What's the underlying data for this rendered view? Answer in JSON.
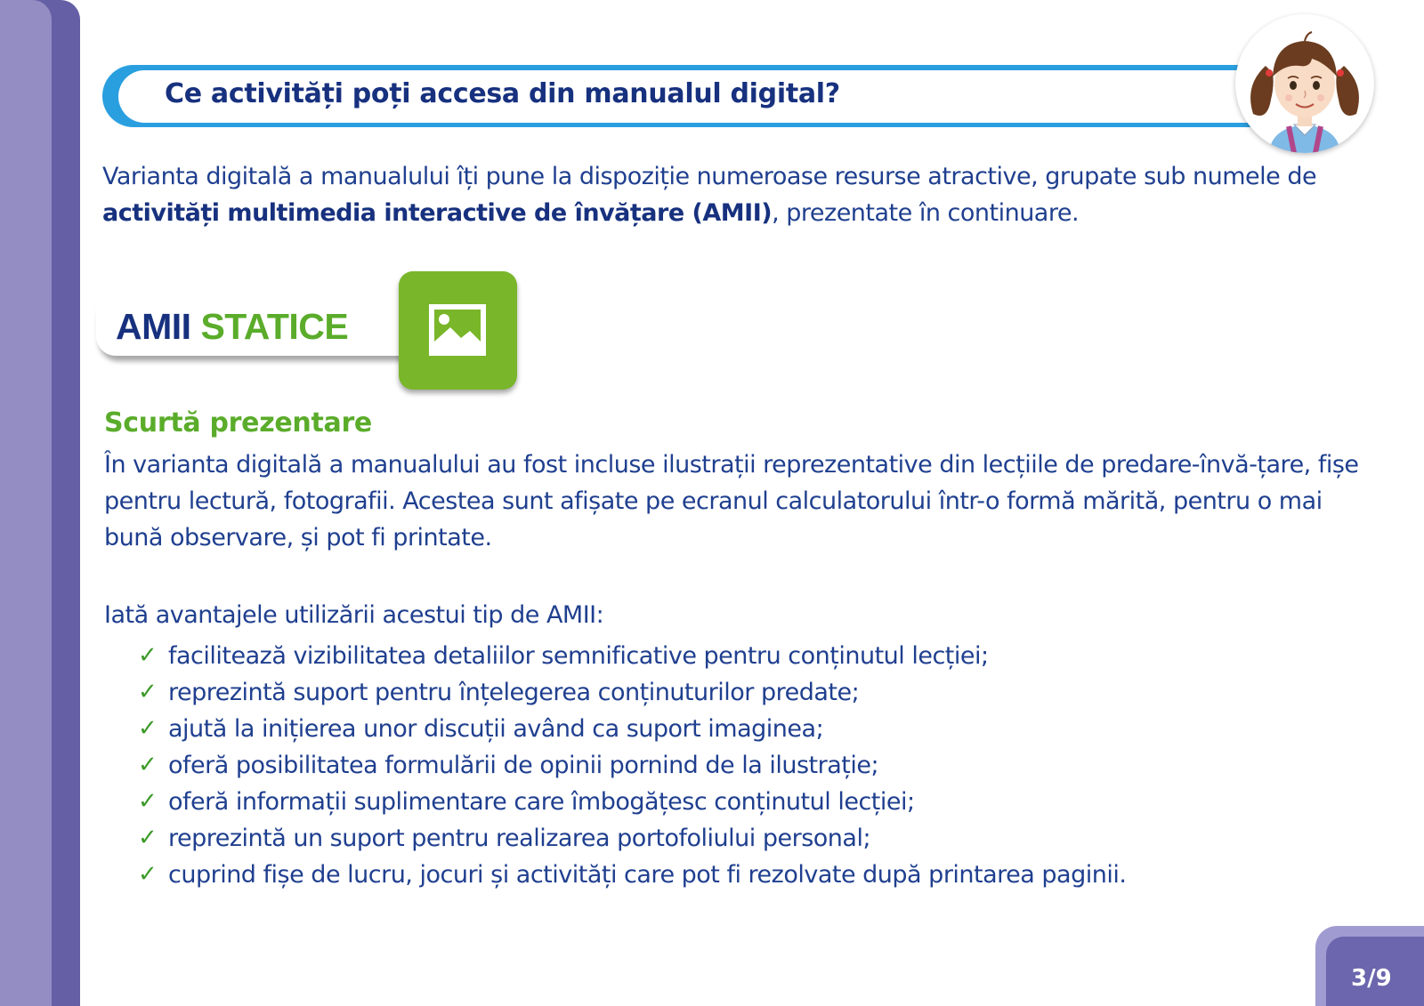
{
  "header": {
    "title": "Ce activități poți accesa din manualul digital?"
  },
  "intro": {
    "text_before": "Varianta digitală a manualului îți pune la dispoziție numeroase resurse atractive, grupate sub numele de ",
    "bold_text": "activități multimedia interactive de învățare (AMII)",
    "text_after": ", prezentate în continuare."
  },
  "section": {
    "title_part1": "AMII",
    "title_part2": "STATICE",
    "icon": "image-icon"
  },
  "summary": {
    "heading": "Scurtă prezentare",
    "paragraph": "În varianta digitală a manualului au fost incluse ilustrații reprezentative din lecțiile de predare-învă-țare, fișe pentru lectură, fotografii. Acestea sunt afișate pe ecranul calculatorului într-o formă mărită, pentru o mai bună observare, și pot fi printate."
  },
  "advantages": {
    "intro": "Iată avantajele utilizării acestui tip de AMII:",
    "check_symbol": "✓",
    "items": [
      "facilitează vizibilitatea detaliilor semnificative pentru conținutul lecției;",
      "reprezintă suport pentru înțelegerea conținuturilor predate;",
      "ajută la inițierea unor discuții având ca suport imaginea;",
      "oferă posibilitatea formulării de opinii pornind de la ilustrație;",
      "oferă informații suplimentare care îmbogățesc conținutul lecției;",
      "reprezintă un suport pentru realizarea portofoliului personal;",
      "cuprind fișe de lucru, jocuri și activități care pot fi rezolvate după printarea paginii."
    ]
  },
  "pagination": {
    "label": "3/9"
  },
  "colors": {
    "navy": "#17317f",
    "text_blue": "#1f3f8f",
    "green": "#5aac2a",
    "tile_green": "#79b62a",
    "band_blue": "#2a9fe0",
    "purple": "#6560a5",
    "light_purple": "#938dc4"
  }
}
